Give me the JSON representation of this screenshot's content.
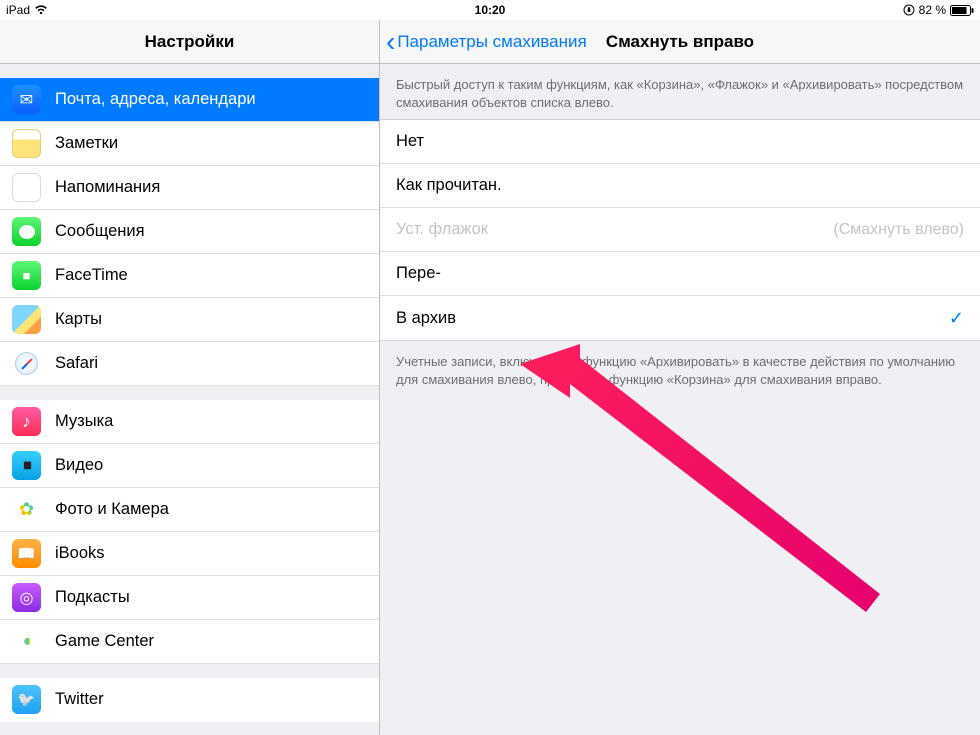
{
  "status": {
    "device": "iPad",
    "time": "10:20",
    "battery_text": "82 %"
  },
  "sidebar": {
    "title": "Настройки",
    "groups": [
      [
        {
          "key": "mail",
          "label": "Почта, адреса, календари",
          "icon": "ic-mail",
          "selected": true
        },
        {
          "key": "notes",
          "label": "Заметки",
          "icon": "ic-notes"
        },
        {
          "key": "reminders",
          "label": "Напоминания",
          "icon": "ic-reminders"
        },
        {
          "key": "messages",
          "label": "Сообщения",
          "icon": "ic-messages"
        },
        {
          "key": "facetime",
          "label": "FaceTime",
          "icon": "ic-facetime"
        },
        {
          "key": "maps",
          "label": "Карты",
          "icon": "ic-maps"
        },
        {
          "key": "safari",
          "label": "Safari",
          "icon": "ic-safari"
        }
      ],
      [
        {
          "key": "music",
          "label": "Музыка",
          "icon": "ic-music"
        },
        {
          "key": "video",
          "label": "Видео",
          "icon": "ic-video"
        },
        {
          "key": "photos",
          "label": "Фото и Камера",
          "icon": "ic-photos"
        },
        {
          "key": "ibooks",
          "label": "iBooks",
          "icon": "ic-ibooks"
        },
        {
          "key": "podcasts",
          "label": "Подкасты",
          "icon": "ic-podcasts"
        },
        {
          "key": "gamecenter",
          "label": "Game Center",
          "icon": "ic-gamecenter"
        }
      ],
      [
        {
          "key": "twitter",
          "label": "Twitter",
          "icon": "ic-twitter"
        }
      ]
    ]
  },
  "detail": {
    "back_label": "Параметры смахивания",
    "title": "Смахнуть вправо",
    "header_desc": "Быстрый доступ к таким функциям, как «Корзина», «Флажок» и «Архивировать» посредством смахивания объектов списка влево.",
    "options": [
      {
        "key": "none",
        "label": "Нет"
      },
      {
        "key": "read",
        "label": "Как прочитан."
      },
      {
        "key": "flag",
        "label": "Уст. флажок",
        "disabled": true,
        "hint": "(Смахнуть влево)"
      },
      {
        "key": "move",
        "label": "Пере-"
      },
      {
        "key": "archive",
        "label": "В архив",
        "checked": true
      }
    ],
    "footer_desc": "Учетные записи, включающие функцию «Архивировать» в качестве действия по умолчанию для смахивания влево, предложат функцию «Корзина» для смахивания вправо."
  }
}
